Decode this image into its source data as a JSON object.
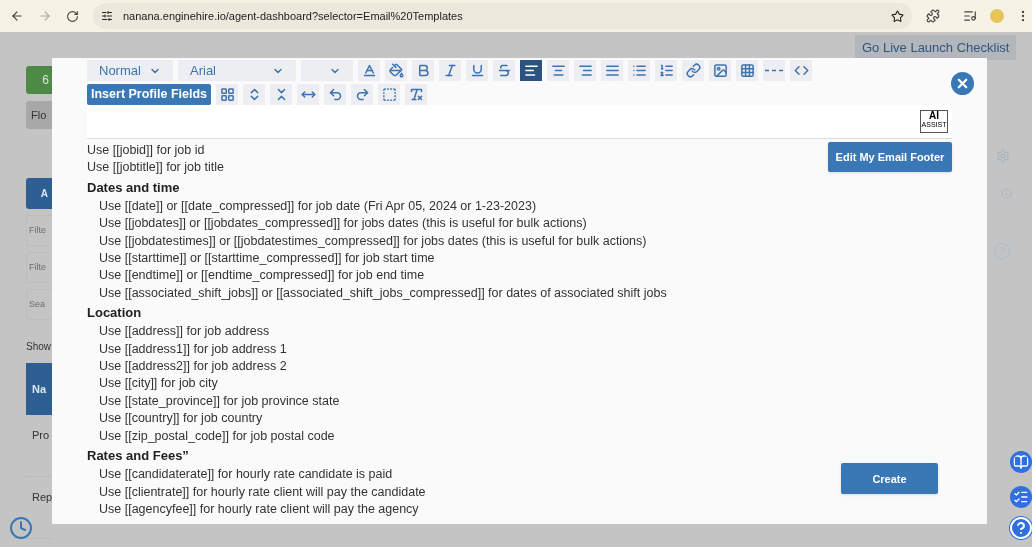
{
  "browser": {
    "url": "nanana.enginehire.io/agent-dashboard?selector=Email%20Templates"
  },
  "background_page": {
    "top_button": "Go Live Launch Checklist",
    "left_items": [
      {
        "kind": "green",
        "text": "6"
      },
      {
        "kind": "gray",
        "text": "Flo"
      },
      {
        "kind": "blue",
        "text": "A"
      },
      {
        "kind": "field",
        "text": "Filte"
      },
      {
        "kind": "field",
        "text": "Filte"
      },
      {
        "kind": "field",
        "text": "Sea"
      },
      {
        "kind": "label",
        "text": "Show"
      },
      {
        "kind": "header",
        "text": "Na"
      },
      {
        "kind": "row",
        "text": "Pro"
      },
      {
        "kind": "row",
        "text": "Rep"
      }
    ]
  },
  "editor": {
    "toolbar": [
      [
        {
          "kind": "select",
          "value": "Normal"
        },
        {
          "kind": "select",
          "value": "Arial"
        },
        {
          "kind": "select"
        },
        {
          "kind": "color",
          "selected": false
        },
        {
          "kind": "fill",
          "selected": false
        },
        {
          "kind": "bold",
          "selected": false
        },
        {
          "kind": "italic",
          "selected": false
        },
        {
          "kind": "underline",
          "selected": false
        },
        {
          "kind": "strike",
          "selected": false
        },
        {
          "kind": "left",
          "selected": true
        },
        {
          "kind": "center",
          "selected": false
        },
        {
          "kind": "right",
          "selected": false
        },
        {
          "kind": "justify",
          "selected": false
        },
        {
          "kind": "bullets",
          "selected": false
        },
        {
          "kind": "numbers",
          "selected": false
        },
        {
          "kind": "link",
          "selected": false
        },
        {
          "kind": "image",
          "selected": false
        },
        {
          "kind": "table",
          "selected": false
        },
        {
          "kind": "rule",
          "selected": false
        },
        {
          "kind": "code",
          "selected": false
        }
      ],
      [
        {
          "kind": "primary",
          "label": "Insert Profile Fields"
        },
        {
          "kind": "selectall",
          "selected": false
        },
        {
          "kind": "expand",
          "selected": false
        },
        {
          "kind": "collapse",
          "selected": false
        },
        {
          "kind": "width",
          "selected": false
        },
        {
          "kind": "undo",
          "selected": false
        },
        {
          "kind": "redo",
          "selected": false
        },
        {
          "kind": "frame",
          "selected": false
        },
        {
          "kind": "clear",
          "selected": false
        }
      ]
    ],
    "ai_badge": {
      "big": "AI",
      "small": "ASSIST"
    }
  },
  "footer_button": "Edit My Email Footer",
  "create_button": "Create",
  "help": [
    {
      "text": "Use [[jobid]] for job id"
    },
    {
      "text": "Use [[jobtitle]] for job title"
    },
    {
      "heading": "Dates and time",
      "children": [
        {
          "text": "Use [[date]] or [[date_compressed]] for job date (Fri Apr 05, 2024 or 1-23-2023)"
        },
        {
          "text": "Use [[jobdates]] or [[jobdates_compressed]] for jobs dates (this is useful for bulk actions)"
        },
        {
          "text": "Use [[jobdatestimes]] or [[jobdatestimes_compressed]] for jobs dates (this is useful for bulk actions)"
        },
        {
          "text": "Use [[starttime]] or [[starttime_compressed]] for job start time"
        },
        {
          "text": "Use [[endtime]] or [[endtime_compressed]] for job end time"
        },
        {
          "text": "Use [[associated_shift_jobs]] or [[associated_shift_jobs_compressed]] for dates of associated shift jobs"
        }
      ]
    },
    {
      "heading": "Location",
      "children": [
        {
          "text": "Use [[address]] for job address"
        },
        {
          "text": "Use [[address1]] for job address 1"
        },
        {
          "text": "Use [[address2]] for job address 2"
        },
        {
          "text": "Use [[city]] for job city"
        },
        {
          "text": "Use [[state_province]] for job province state"
        },
        {
          "text": "Use [[country]] for job country"
        },
        {
          "text": "Use [[zip_postal_code]] for job postal code"
        }
      ]
    },
    {
      "heading": "Rates and Fees”",
      "children": [
        {
          "text": "Use [[candidaterate]] for hourly rate candidate is paid"
        },
        {
          "text": "Use [[clientrate]] for hourly rate client will pay the candidate"
        },
        {
          "text": "Use [[agencyfee]] for hourly rate client will pay the agency"
        }
      ]
    }
  ]
}
